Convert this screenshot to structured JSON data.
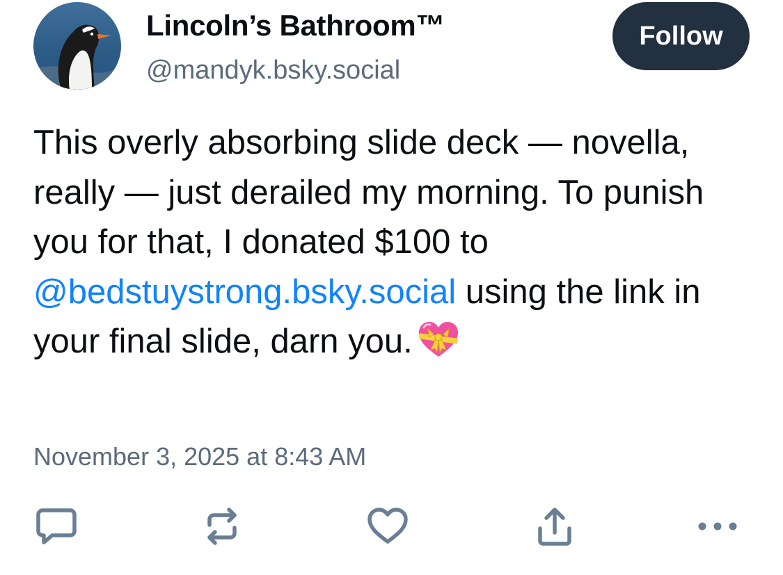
{
  "author": {
    "display_name": "Lincoln’s Bathroom™",
    "handle": "@mandyk.bsky.social",
    "avatar": "gentoo-penguin-avatar"
  },
  "follow_button": {
    "label": "Follow"
  },
  "post": {
    "text_before_mention": "This overly absorbing slide deck — novella, really — just derailed my morning. To punish you for that, I donated $100 to ",
    "mention": "@bedstuystrong.bsky.social",
    "text_after_mention": " using the link in your final slide, darn you.",
    "emoji": "heart-with-ribbon-icon",
    "timestamp": "November 3, 2025 at 8:43 AM"
  },
  "actions": [
    {
      "name": "reply-icon"
    },
    {
      "name": "repost-icon"
    },
    {
      "name": "like-icon"
    },
    {
      "name": "share-icon"
    },
    {
      "name": "more-options-icon"
    }
  ],
  "colors": {
    "text": "#0b0f14",
    "secondary_text": "#5b6b7b",
    "mention_link": "#1083fe",
    "follow_button_bg": "#223040",
    "action_icon": "#6a7f94"
  }
}
